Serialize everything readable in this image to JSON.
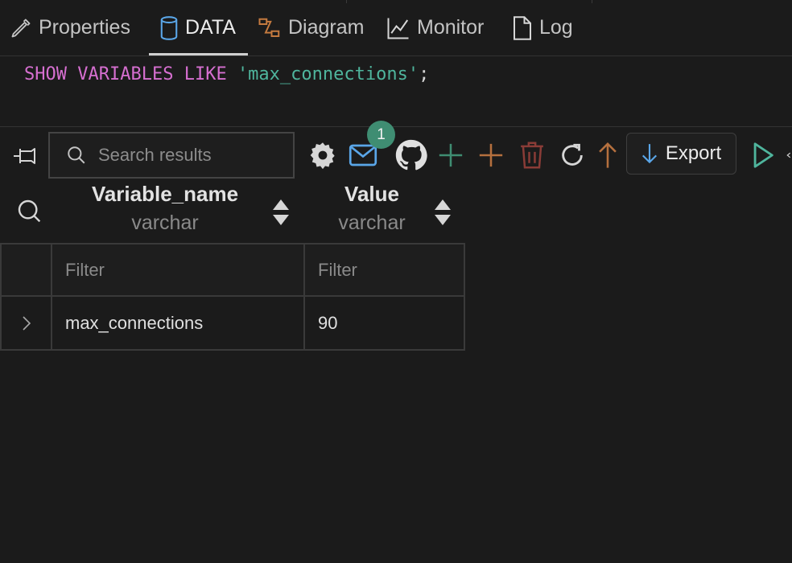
{
  "tabs": [
    {
      "label": "Properties",
      "icon": "pencil-icon"
    },
    {
      "label": "DATA",
      "icon": "database-icon",
      "active": true
    },
    {
      "label": "Diagram",
      "icon": "diagram-icon"
    },
    {
      "label": "Monitor",
      "icon": "chart-line-icon"
    },
    {
      "label": "Log",
      "icon": "document-icon"
    }
  ],
  "editor": {
    "kw1": "SHOW",
    "kw2": "VARIABLES",
    "kw3": "LIKE",
    "string": "'max_connections'",
    "terminator": ";"
  },
  "toolbar": {
    "search_placeholder": "Search results",
    "notification_count": "1",
    "export_label": "Export",
    "colors": {
      "add_green": "#3f8d72",
      "add_orange": "#b5703e",
      "delete_red": "#8a3c37",
      "run_green": "#4fb59d",
      "mail_blue": "#5aa6e8"
    }
  },
  "columns": [
    {
      "name": "Variable_name",
      "type": "varchar"
    },
    {
      "name": "Value",
      "type": "varchar"
    }
  ],
  "filters": {
    "col1": "Filter",
    "col2": "Filter"
  },
  "rows": [
    {
      "variable_name": "max_connections",
      "value": "90"
    }
  ]
}
